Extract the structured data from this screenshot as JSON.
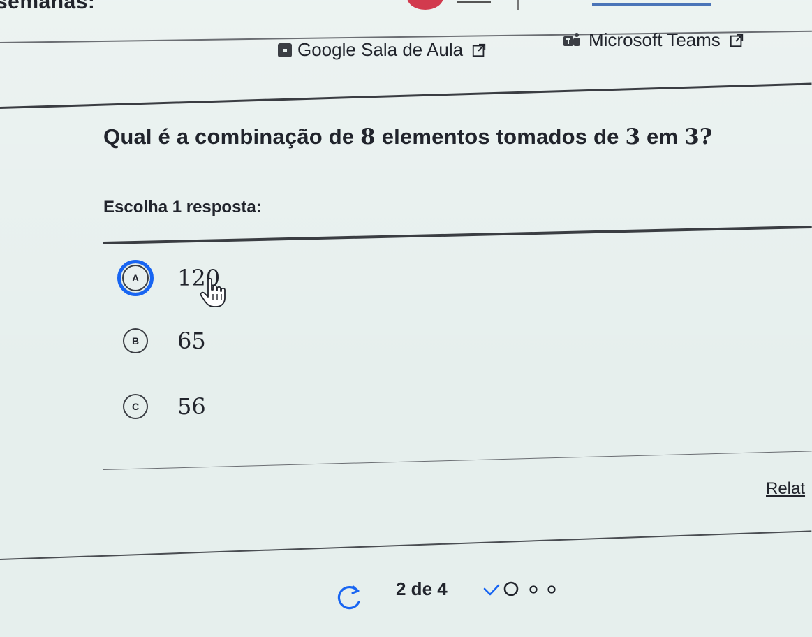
{
  "header": {
    "partial_heading": "semanas:"
  },
  "share": {
    "google_classroom": "Google Sala de Aula",
    "microsoft_teams": "Microsoft Teams"
  },
  "question": {
    "text_part1": "Qual é a combinação de ",
    "n": "8",
    "text_part2": " elementos tomados de ",
    "k": "3",
    "text_part3": " em ",
    "k2": "3",
    "text_part4": "?"
  },
  "instruction": "Escolha 1 resposta:",
  "choices": [
    {
      "letter": "A",
      "value": "120",
      "selected": true
    },
    {
      "letter": "B",
      "value": "65",
      "selected": false
    },
    {
      "letter": "C",
      "value": "56",
      "selected": false
    }
  ],
  "report_link": "Relat",
  "footer": {
    "progress_text": "2 de 4"
  },
  "colors": {
    "accent_blue": "#1865f2",
    "text": "#21242c",
    "background": "#e6efed"
  },
  "icons": {
    "external_link": "external-link-icon",
    "retry": "retry-icon",
    "cursor": "hand-pointer-icon"
  }
}
